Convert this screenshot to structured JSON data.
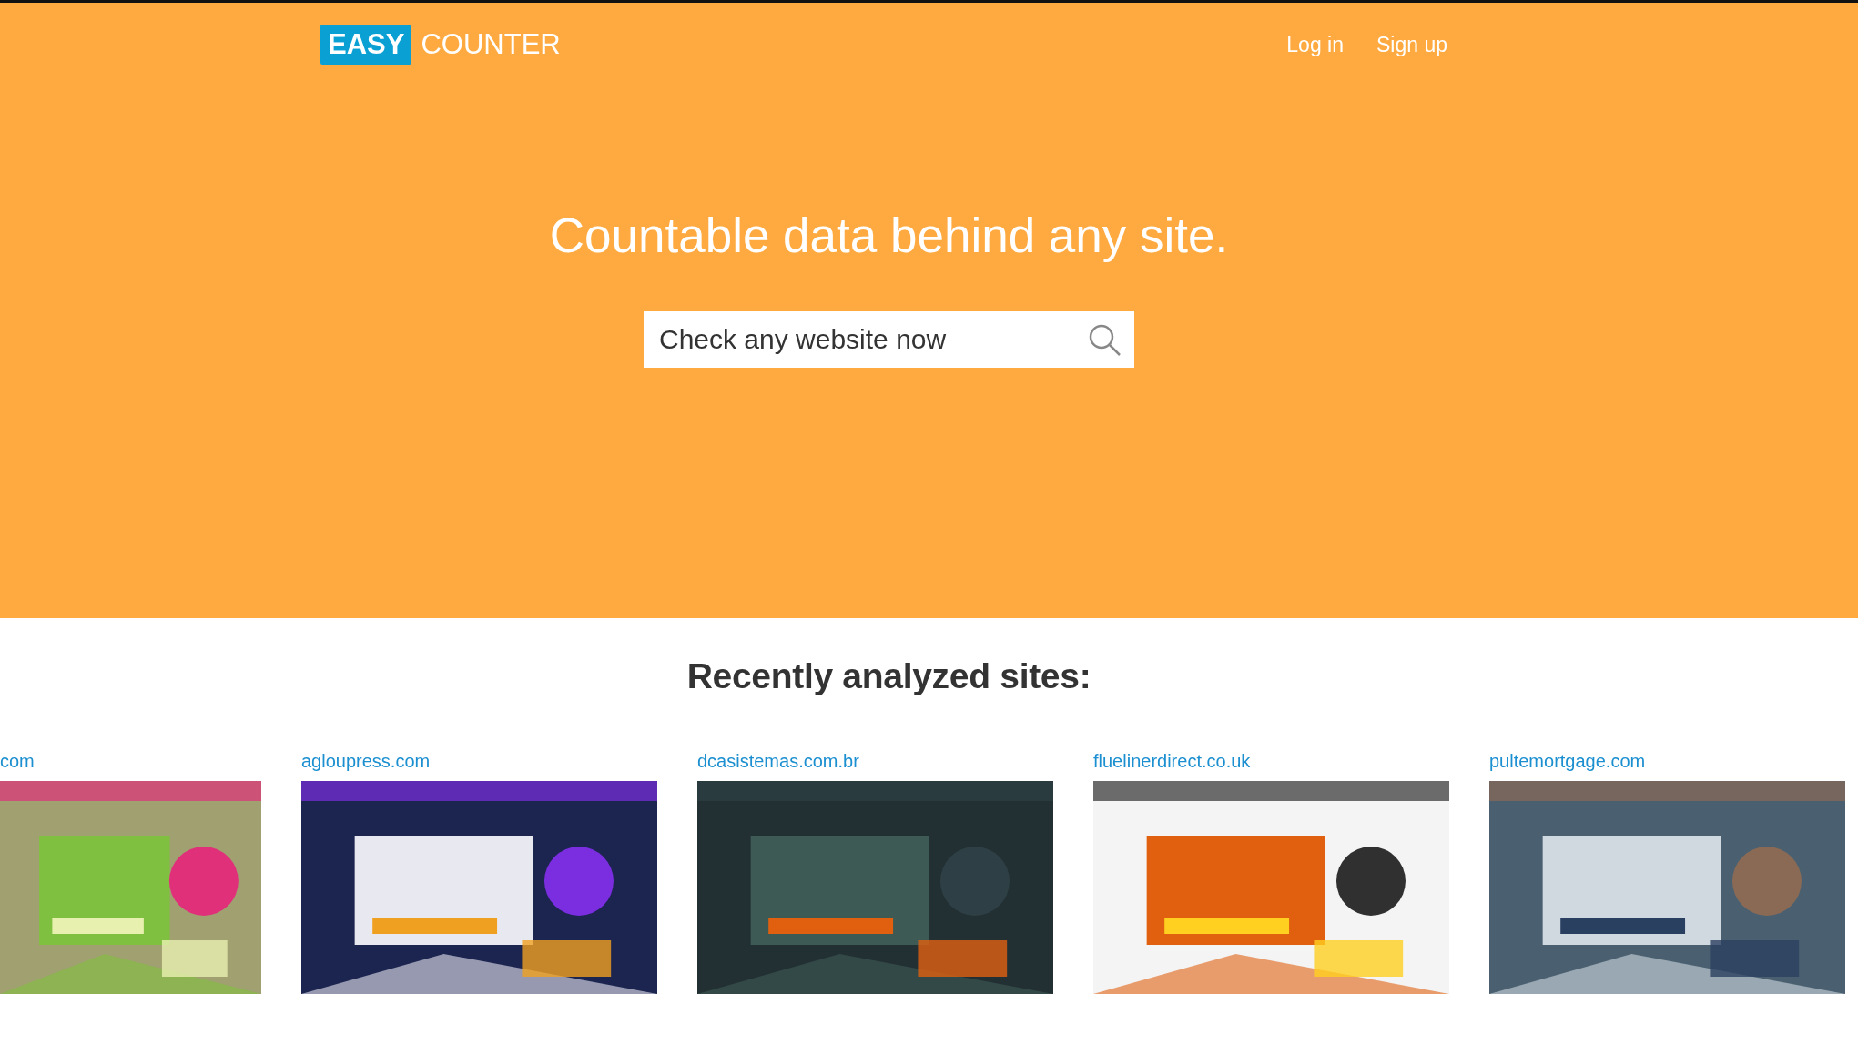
{
  "header": {
    "logo": {
      "badge": "EASY",
      "text": "COUNTER"
    },
    "nav": [
      "Log in",
      "Sign up"
    ]
  },
  "hero": {
    "title": "Countable data behind any site.",
    "search": {
      "placeholder": "Check any website now"
    }
  },
  "recent": {
    "title": "Recently analyzed sites:",
    "sites": [
      {
        "label": "com",
        "kind": "picture"
      },
      {
        "label": "agloupress.com",
        "kind": "picture"
      },
      {
        "label": "dcasistemas.com.br",
        "kind": "picture"
      },
      {
        "label": "fluelinerdirect.co.uk",
        "kind": "picture"
      },
      {
        "label": "pultemortgage.com",
        "kind": "picture"
      }
    ]
  }
}
